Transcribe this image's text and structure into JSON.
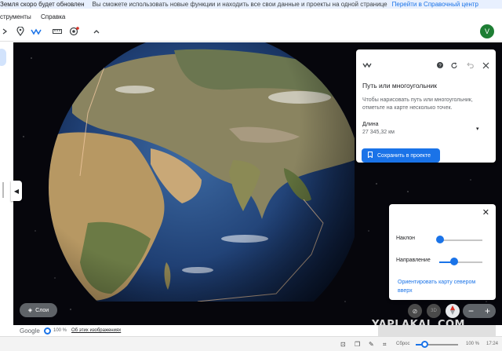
{
  "banner": {
    "text_left": "Земля скоро будет обновлен",
    "text_mid": "Вы сможете использовать новые функции и находить все свои данные и проекты на одной странице",
    "link": "Перейти в Справочный центр"
  },
  "menubar": {
    "items": [
      "струменты",
      "Справка"
    ]
  },
  "toolbar": {
    "avatar_letter": "V",
    "icons": [
      "search-icon",
      "place-pin-icon",
      "path-icon",
      "ruler-icon",
      "record-tour-icon",
      "collapse-chevron-icon"
    ]
  },
  "path_panel": {
    "title": "Путь или многоугольник",
    "description": "Чтобы нарисовать путь или многоугольник, отметьте на карте несколько точек.",
    "length_label": "Длина",
    "length_value": "27 345,32 км",
    "save_label": "Сохранить в проекте",
    "accent": "#1a73e8"
  },
  "nav_panel": {
    "tilt_label": "Наклон",
    "tilt_value": 0,
    "heading_label": "Направление",
    "heading_value": 0.3,
    "orient_link": "Ориентировать карту севером вверх"
  },
  "map_controls": {
    "layers_label": "Слои",
    "mode_3d_label": "3D",
    "zoom_out": "−",
    "zoom_in": "+"
  },
  "watermark": "YAPLAKAL.COM",
  "statusbar": {
    "brand": "Google",
    "load_percent": "100 %",
    "about_images": "Об этих изображениях"
  },
  "taskbar": {
    "reset_label": "Сброс",
    "zoom_percent": "100 %",
    "time": "17:24"
  }
}
